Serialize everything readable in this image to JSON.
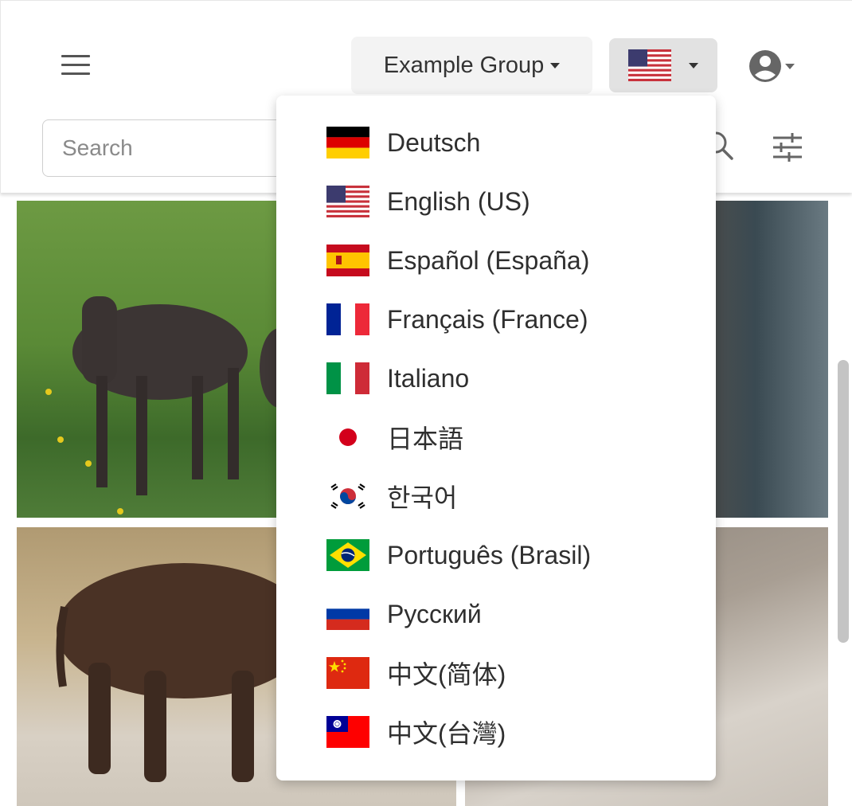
{
  "header": {
    "group_label": "Example Group",
    "search_placeholder": "Search"
  },
  "icons": {
    "menu": "hamburger-menu-icon",
    "user": "account-circle-icon",
    "search": "search-icon",
    "filter": "tune-icon"
  },
  "colors": {
    "menu_bg": "#ffffff",
    "selected_button_bg": "#e2e2e2",
    "group_button_bg": "#f3f3f3"
  },
  "language_menu": {
    "selected": "English (US)",
    "items": [
      {
        "label": "Deutsch",
        "flag": "de"
      },
      {
        "label": "English (US)",
        "flag": "us"
      },
      {
        "label": "Español (España)",
        "flag": "es"
      },
      {
        "label": "Français (France)",
        "flag": "fr"
      },
      {
        "label": "Italiano",
        "flag": "it"
      },
      {
        "label": "日本語",
        "flag": "jp"
      },
      {
        "label": "한국어",
        "flag": "kr"
      },
      {
        "label": "Português (Brasil)",
        "flag": "br"
      },
      {
        "label": "Русский",
        "flag": "ru"
      },
      {
        "label": "中文(简体)",
        "flag": "cn"
      },
      {
        "label": "中文(台灣)",
        "flag": "tw"
      }
    ]
  }
}
